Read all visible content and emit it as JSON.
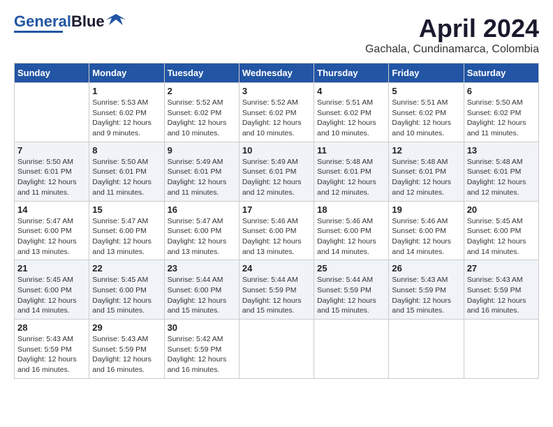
{
  "header": {
    "logo_line1": "General",
    "logo_line2": "Blue",
    "month": "April 2024",
    "location": "Gachala, Cundinamarca, Colombia"
  },
  "days_of_week": [
    "Sunday",
    "Monday",
    "Tuesday",
    "Wednesday",
    "Thursday",
    "Friday",
    "Saturday"
  ],
  "weeks": [
    [
      {
        "day": "",
        "info": ""
      },
      {
        "day": "1",
        "info": "Sunrise: 5:53 AM\nSunset: 6:02 PM\nDaylight: 12 hours\nand 9 minutes."
      },
      {
        "day": "2",
        "info": "Sunrise: 5:52 AM\nSunset: 6:02 PM\nDaylight: 12 hours\nand 10 minutes."
      },
      {
        "day": "3",
        "info": "Sunrise: 5:52 AM\nSunset: 6:02 PM\nDaylight: 12 hours\nand 10 minutes."
      },
      {
        "day": "4",
        "info": "Sunrise: 5:51 AM\nSunset: 6:02 PM\nDaylight: 12 hours\nand 10 minutes."
      },
      {
        "day": "5",
        "info": "Sunrise: 5:51 AM\nSunset: 6:02 PM\nDaylight: 12 hours\nand 10 minutes."
      },
      {
        "day": "6",
        "info": "Sunrise: 5:50 AM\nSunset: 6:02 PM\nDaylight: 12 hours\nand 11 minutes."
      }
    ],
    [
      {
        "day": "7",
        "info": "Sunrise: 5:50 AM\nSunset: 6:01 PM\nDaylight: 12 hours\nand 11 minutes."
      },
      {
        "day": "8",
        "info": "Sunrise: 5:50 AM\nSunset: 6:01 PM\nDaylight: 12 hours\nand 11 minutes."
      },
      {
        "day": "9",
        "info": "Sunrise: 5:49 AM\nSunset: 6:01 PM\nDaylight: 12 hours\nand 11 minutes."
      },
      {
        "day": "10",
        "info": "Sunrise: 5:49 AM\nSunset: 6:01 PM\nDaylight: 12 hours\nand 12 minutes."
      },
      {
        "day": "11",
        "info": "Sunrise: 5:48 AM\nSunset: 6:01 PM\nDaylight: 12 hours\nand 12 minutes."
      },
      {
        "day": "12",
        "info": "Sunrise: 5:48 AM\nSunset: 6:01 PM\nDaylight: 12 hours\nand 12 minutes."
      },
      {
        "day": "13",
        "info": "Sunrise: 5:48 AM\nSunset: 6:01 PM\nDaylight: 12 hours\nand 12 minutes."
      }
    ],
    [
      {
        "day": "14",
        "info": "Sunrise: 5:47 AM\nSunset: 6:00 PM\nDaylight: 12 hours\nand 13 minutes."
      },
      {
        "day": "15",
        "info": "Sunrise: 5:47 AM\nSunset: 6:00 PM\nDaylight: 12 hours\nand 13 minutes."
      },
      {
        "day": "16",
        "info": "Sunrise: 5:47 AM\nSunset: 6:00 PM\nDaylight: 12 hours\nand 13 minutes."
      },
      {
        "day": "17",
        "info": "Sunrise: 5:46 AM\nSunset: 6:00 PM\nDaylight: 12 hours\nand 13 minutes."
      },
      {
        "day": "18",
        "info": "Sunrise: 5:46 AM\nSunset: 6:00 PM\nDaylight: 12 hours\nand 14 minutes."
      },
      {
        "day": "19",
        "info": "Sunrise: 5:46 AM\nSunset: 6:00 PM\nDaylight: 12 hours\nand 14 minutes."
      },
      {
        "day": "20",
        "info": "Sunrise: 5:45 AM\nSunset: 6:00 PM\nDaylight: 12 hours\nand 14 minutes."
      }
    ],
    [
      {
        "day": "21",
        "info": "Sunrise: 5:45 AM\nSunset: 6:00 PM\nDaylight: 12 hours\nand 14 minutes."
      },
      {
        "day": "22",
        "info": "Sunrise: 5:45 AM\nSunset: 6:00 PM\nDaylight: 12 hours\nand 15 minutes."
      },
      {
        "day": "23",
        "info": "Sunrise: 5:44 AM\nSunset: 6:00 PM\nDaylight: 12 hours\nand 15 minutes."
      },
      {
        "day": "24",
        "info": "Sunrise: 5:44 AM\nSunset: 5:59 PM\nDaylight: 12 hours\nand 15 minutes."
      },
      {
        "day": "25",
        "info": "Sunrise: 5:44 AM\nSunset: 5:59 PM\nDaylight: 12 hours\nand 15 minutes."
      },
      {
        "day": "26",
        "info": "Sunrise: 5:43 AM\nSunset: 5:59 PM\nDaylight: 12 hours\nand 15 minutes."
      },
      {
        "day": "27",
        "info": "Sunrise: 5:43 AM\nSunset: 5:59 PM\nDaylight: 12 hours\nand 16 minutes."
      }
    ],
    [
      {
        "day": "28",
        "info": "Sunrise: 5:43 AM\nSunset: 5:59 PM\nDaylight: 12 hours\nand 16 minutes."
      },
      {
        "day": "29",
        "info": "Sunrise: 5:43 AM\nSunset: 5:59 PM\nDaylight: 12 hours\nand 16 minutes."
      },
      {
        "day": "30",
        "info": "Sunrise: 5:42 AM\nSunset: 5:59 PM\nDaylight: 12 hours\nand 16 minutes."
      },
      {
        "day": "",
        "info": ""
      },
      {
        "day": "",
        "info": ""
      },
      {
        "day": "",
        "info": ""
      },
      {
        "day": "",
        "info": ""
      }
    ]
  ]
}
